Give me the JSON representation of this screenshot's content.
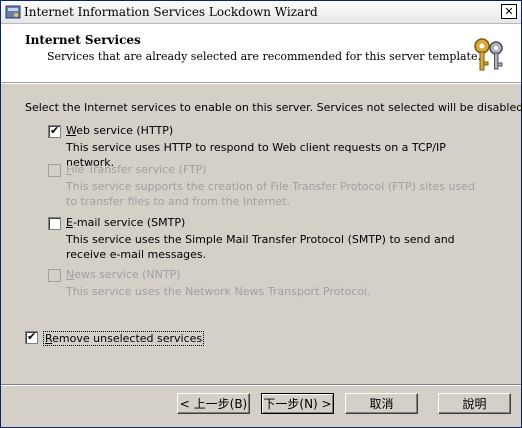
{
  "window": {
    "title": "Internet Information Services Lockdown Wizard",
    "close_label": "✕"
  },
  "header": {
    "title": "Internet Services",
    "subtitle": "Services that are already selected are recommended for this server template."
  },
  "intro": "Select the Internet services to enable on this server. Services not selected will be disabled.",
  "services": [
    {
      "label_key": "W",
      "label_rest": "eb service (HTTP)",
      "checked": true,
      "enabled": true,
      "description": "This service uses HTTP to respond to Web client requests on a TCP/IP network."
    },
    {
      "label_key": "F",
      "label_rest": "ile Transfer service (FTP)",
      "checked": false,
      "enabled": false,
      "description": "This service supports the creation of File Transfer Protocol (FTP) sites used to transfer files to and from the Internet."
    },
    {
      "label_key": "E",
      "label_rest": "-mail service (SMTP)",
      "checked": false,
      "enabled": true,
      "description": "This service uses the Simple Mail Transfer Protocol (SMTP) to send and receive e-mail messages."
    },
    {
      "label_key": "N",
      "label_rest": "ews service (NNTP)",
      "checked": false,
      "enabled": false,
      "description": "This service uses the Network News Transport Protocol."
    }
  ],
  "remove": {
    "label_key": "R",
    "label_rest": "emove unselected services",
    "checked": true
  },
  "buttons": {
    "back": "< 上一步(B)",
    "next": "下一步(N) >",
    "cancel": "取消",
    "help": "說明"
  },
  "check_glyph": "✔"
}
